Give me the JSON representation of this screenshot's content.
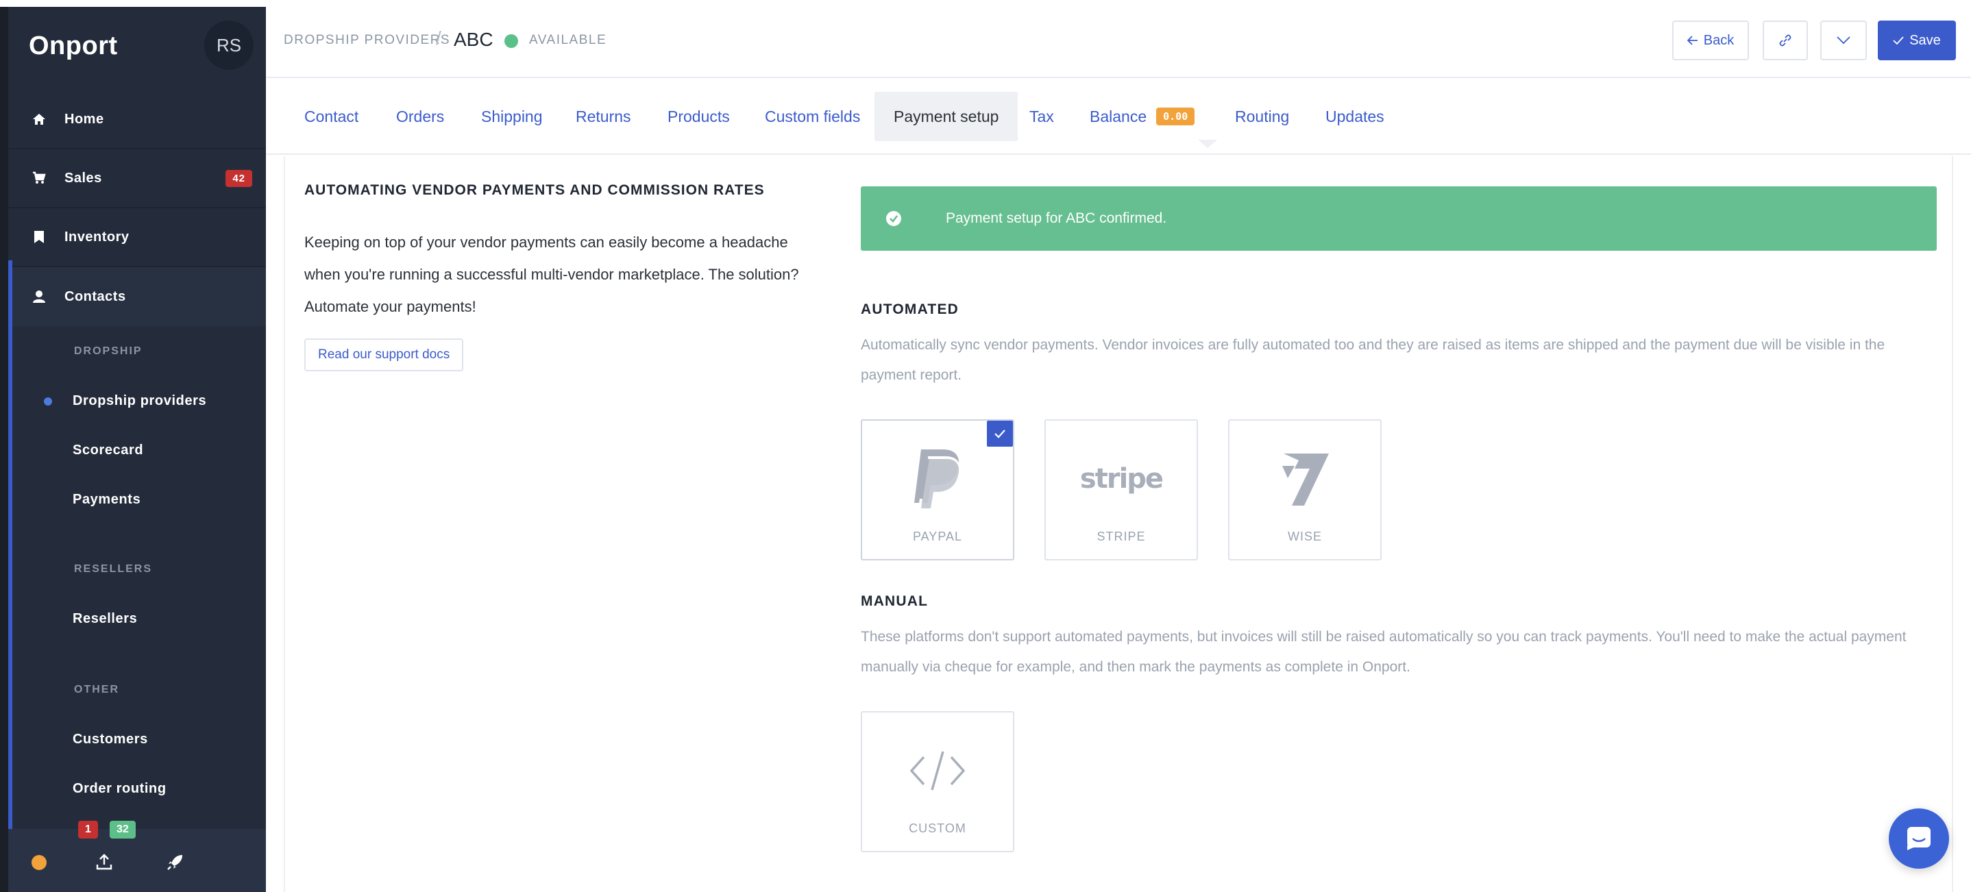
{
  "app": {
    "name": "Onport",
    "user_initials": "RS"
  },
  "sidebar": {
    "main_items": [
      {
        "label": "Home",
        "icon": "home-icon"
      },
      {
        "label": "Sales",
        "icon": "cart-icon",
        "badge": "42"
      },
      {
        "label": "Inventory",
        "icon": "bookmark-icon"
      },
      {
        "label": "Contacts",
        "icon": "user-icon"
      }
    ],
    "sections": [
      {
        "label": "DROPSHIP",
        "items": [
          "Dropship providers",
          "Scorecard",
          "Payments"
        ]
      },
      {
        "label": "RESELLERS",
        "items": [
          "Resellers"
        ]
      },
      {
        "label": "OTHER",
        "items": [
          "Customers",
          "Order routing"
        ]
      }
    ],
    "footer": {
      "badge_red": "1",
      "badge_green": "32"
    }
  },
  "header": {
    "breadcrumb": "DROPSHIP PROVIDERS",
    "separator": "/",
    "title": "ABC",
    "status": "AVAILABLE",
    "back_label": "Back",
    "save_label": "Save"
  },
  "tabs": [
    {
      "label": "Contact"
    },
    {
      "label": "Orders"
    },
    {
      "label": "Shipping"
    },
    {
      "label": "Returns"
    },
    {
      "label": "Products"
    },
    {
      "label": "Custom fields"
    },
    {
      "label": "Payment setup",
      "active": true
    },
    {
      "label": "Tax"
    },
    {
      "label": "Balance",
      "badge": "0.00"
    },
    {
      "label": "Routing"
    },
    {
      "label": "Updates"
    }
  ],
  "intro": {
    "heading": "AUTOMATING VENDOR PAYMENTS AND COMMISSION RATES",
    "paragraph": "Keeping on top of your vendor payments can easily become a headache when you're running a successful multi-vendor marketplace. The solution? Automate your payments!",
    "support_link": "Read our support docs"
  },
  "alert": {
    "message": "Payment setup for ABC confirmed."
  },
  "automated": {
    "title": "AUTOMATED",
    "description": "Automatically sync vendor payments. Vendor invoices are fully automated too and they are raised as items are shipped and the payment due will be visible in the payment report.",
    "providers": [
      {
        "label": "PAYPAL",
        "selected": true
      },
      {
        "label": "STRIPE",
        "logo_text": "stripe",
        "selected": false
      },
      {
        "label": "WISE",
        "selected": false
      }
    ]
  },
  "manual": {
    "title": "MANUAL",
    "description": "These platforms don't support automated payments, but invoices will still be raised automatically so you can track payments. You'll need to make the actual payment manually via cheque for example, and then mark the payments as complete in Onport.",
    "providers": [
      {
        "label": "CUSTOM"
      }
    ]
  },
  "colors": {
    "accent": "#3b5bcb",
    "sidebar_bg": "#242c3b",
    "success": "#66bf90",
    "warning": "#f2a23a",
    "danger": "#c53030"
  }
}
